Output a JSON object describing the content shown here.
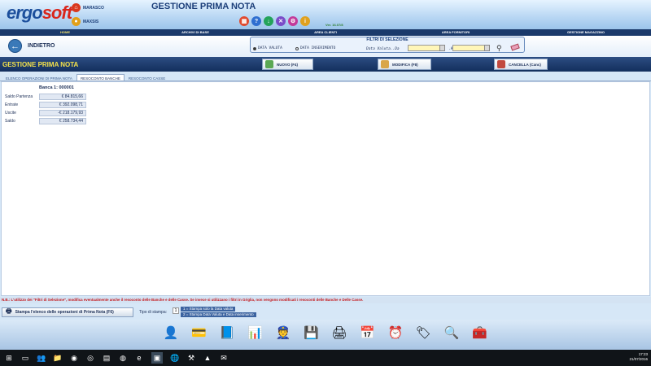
{
  "app": {
    "logo_main": "ergo",
    "logo_accent": "soft",
    "title": "GESTIONE PRIMA NOTA",
    "version": "Ver. 16.07/8",
    "users": [
      "MARASCO",
      "MAXSIS"
    ]
  },
  "toolbar_icons": [
    {
      "icon": "calculator-icon",
      "glyph": "▦",
      "color": "#e04a2f"
    },
    {
      "icon": "help-icon",
      "glyph": "?",
      "color": "#2f6fd0"
    },
    {
      "icon": "download-icon",
      "glyph": "↓",
      "color": "#23a35a"
    },
    {
      "icon": "close-icon",
      "glyph": "✕",
      "color": "#7a4cc8"
    },
    {
      "icon": "settings-icon",
      "glyph": "⚙",
      "color": "#c23b9a"
    },
    {
      "icon": "info-icon",
      "glyph": "i",
      "color": "#e0a11f"
    }
  ],
  "nav": {
    "items": [
      "HOME",
      "ARCHIVI DI BASE",
      "AREA CLIENTI",
      "AREA FORNITORI",
      "GESTIONE MAGAZZINO"
    ],
    "active": "HOME"
  },
  "back": {
    "label": "INDIETRO"
  },
  "filters": {
    "title": "FILTRI DI SELEZIONE",
    "option_value_date": "DATA VALUTA",
    "option_insert_date": "DATA INSERIMENTO",
    "date_from_label": "Data Valuta..Da",
    "date_to_label": ".A",
    "date_from": "",
    "date_to": ""
  },
  "page": {
    "title": "GESTIONE PRIMA NOTA"
  },
  "actions": {
    "new": "NUOVO (F4)",
    "edit": "MODIFICA (F8)",
    "delete": "CANCELLA (Canc)"
  },
  "tabs": [
    "ELENCO OPERAZIONI DI PRIMA NOTA",
    "RESOCONTO BANCHE",
    "RESOCONTO CASSE"
  ],
  "active_tab": "RESOCONTO BANCHE",
  "bank": {
    "title": "Banca 1: 000001",
    "rows": [
      {
        "label": "Saldo Partenza",
        "value": "€ 84.815,66"
      },
      {
        "label": "Entrate",
        "value": "€ 392.098,71"
      },
      {
        "label": "Uscite",
        "value": "-€ 218.179,93"
      },
      {
        "label": "Saldo",
        "value": "€ 258.734,44"
      }
    ]
  },
  "note": "N.B.: L'utilizzo dei \"Filtri di Selezione\", modifica eventualmente anche il resoconto delle Banche e delle Casse. Se invece si utilizzano i filtri in Griglia, non vengono modificati i resoconti delle Banche e Delle Casse.",
  "print": {
    "button": "Stampa l'elenco delle operazioni di Prima Nota (F6)",
    "type_label": "Tipo di stampa:",
    "type_value": "1",
    "option_1": "1 = Stampa solo la Data valuta",
    "option_2": "2 = Stampa Data Valuta e Data inserimento"
  },
  "dock_icons": [
    {
      "name": "clients-icon",
      "glyph": "👤"
    },
    {
      "name": "card-icon",
      "glyph": "💳"
    },
    {
      "name": "binder-icon",
      "glyph": "📘"
    },
    {
      "name": "chart-icon",
      "glyph": "📊"
    },
    {
      "name": "security-user-icon",
      "glyph": "👮"
    },
    {
      "name": "save-disk-icon",
      "glyph": "💾"
    },
    {
      "name": "printer-icon",
      "glyph": "🖨"
    },
    {
      "name": "calendar-icon",
      "glyph": "📅"
    },
    {
      "name": "clock-icon",
      "glyph": "⏰"
    },
    {
      "name": "tag-icon",
      "glyph": "🏷"
    },
    {
      "name": "search-icon",
      "glyph": "🔍"
    },
    {
      "name": "tools-icon",
      "glyph": "🧰"
    }
  ],
  "taskbar": {
    "time": "17:23",
    "date": "21/07/2016"
  }
}
